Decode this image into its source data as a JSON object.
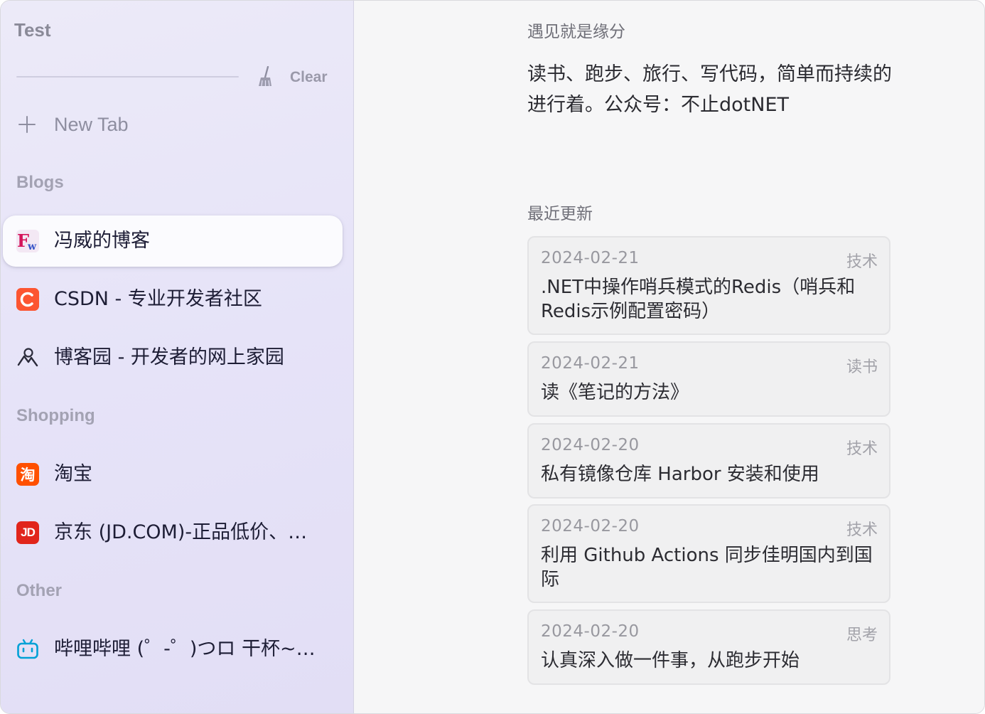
{
  "sidebar": {
    "space_title": "Test",
    "clear_label": "Clear",
    "new_tab_label": "New Tab",
    "sections": {
      "blogs": {
        "header": "Blogs",
        "items": [
          {
            "title": "冯威的博客",
            "icon": "fw-icon",
            "active": true
          },
          {
            "title": "CSDN - 专业开发者社区",
            "icon": "csdn-icon",
            "active": false
          },
          {
            "title": "博客园 - 开发者的网上家园",
            "icon": "cnblogs-icon",
            "active": false
          }
        ]
      },
      "shopping": {
        "header": "Shopping",
        "items": [
          {
            "title": "淘宝",
            "icon": "taobao-icon",
            "active": false
          },
          {
            "title": "京东 (JD.COM)-正品低价、…",
            "icon": "jd-icon",
            "active": false
          }
        ]
      },
      "other": {
        "header": "Other",
        "items": [
          {
            "title": "哔哩哔哩 (゜-゜)つロ 干杯~…",
            "icon": "bilibili-icon",
            "active": false
          }
        ]
      }
    }
  },
  "main": {
    "greeting": "遇见就是缘分",
    "bio": "读书、跑步、旅行、写代码，简单而持续的进行着。公众号：不止dotNET",
    "recent_title": "最近更新",
    "posts": [
      {
        "date": "2024-02-21",
        "tag": "技术",
        "title": ".NET中操作哨兵模式的Redis（哨兵和Redis示例配置密码）"
      },
      {
        "date": "2024-02-21",
        "tag": "读书",
        "title": "读《笔记的方法》"
      },
      {
        "date": "2024-02-20",
        "tag": "技术",
        "title": "私有镜像仓库 Harbor 安装和使用"
      },
      {
        "date": "2024-02-20",
        "tag": "技术",
        "title": "利用 Github Actions 同步佳明国内到国际"
      },
      {
        "date": "2024-02-20",
        "tag": "思考",
        "title": "认真深入做一件事，从跑步开始"
      }
    ]
  },
  "colors": {
    "csdn": "#fc5531",
    "taobao": "#ff5000",
    "jd": "#e1251b",
    "bilibili": "#00a1d6",
    "fw_red": "#d4145a",
    "fw_blue": "#3a56c8"
  }
}
